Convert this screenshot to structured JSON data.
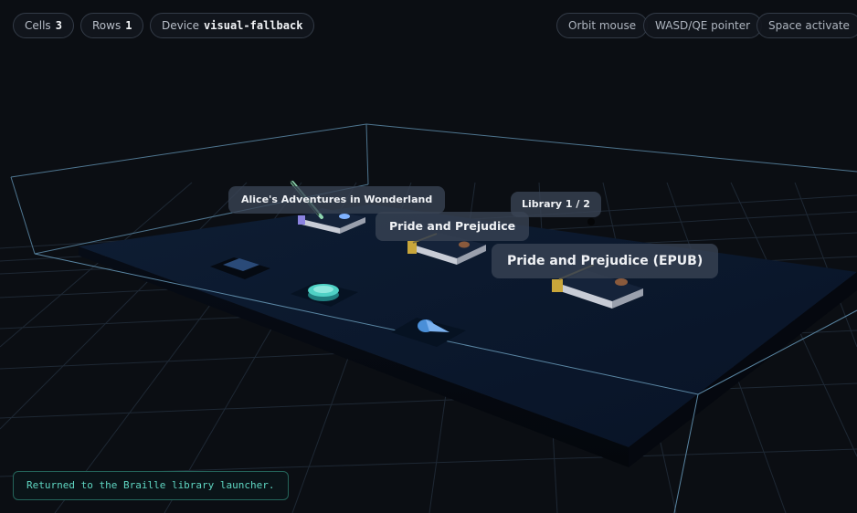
{
  "hud": {
    "cells_label": "Cells",
    "cells_value": "3",
    "rows_label": "Rows",
    "rows_value": "1",
    "device_label": "Device",
    "device_value": "visual-fallback"
  },
  "controls": {
    "orbit": "Orbit mouse",
    "pointer": "WASD/QE pointer",
    "activate": "Space activate"
  },
  "scene": {
    "items": [
      {
        "title": "Alice's Adventures in Wonderland"
      },
      {
        "title": "Pride and Prejudice"
      },
      {
        "title": "Pride and Prejudice (EPUB)"
      }
    ],
    "library_page": "Library 1 / 2"
  },
  "status_message": "Returned to the Braille library launcher.",
  "colors": {
    "background": "#0b0e13",
    "platform_top": "#0d1b30",
    "grid_line": "#2b3a4c",
    "accent_teal": "#4fd1c5",
    "accent_blue": "#4a8fd8",
    "status_text": "#5fd6c2"
  }
}
